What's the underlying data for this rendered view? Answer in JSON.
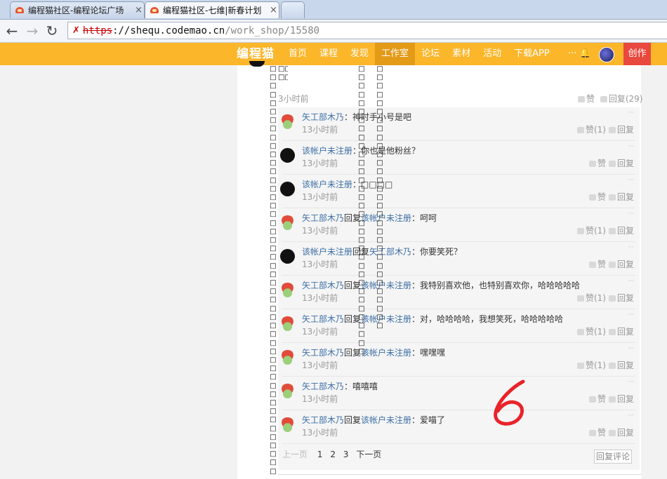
{
  "browser": {
    "tabs": [
      {
        "title": "编程猫社区-编程论坛广场",
        "active": false
      },
      {
        "title": "编程猫社区-七维|新春计划",
        "active": true
      },
      {
        "title": "",
        "active": false
      }
    ],
    "close_glyph": "×",
    "url": {
      "scheme": "https",
      "host": "://shequ.codemao.cn",
      "path": "/work_shop/15580"
    }
  },
  "header": {
    "logo": "编程猫",
    "nav": [
      {
        "label": "首页",
        "active": false
      },
      {
        "label": "课程",
        "active": false
      },
      {
        "label": "发现",
        "active": false
      },
      {
        "label": "工作室",
        "active": true
      },
      {
        "label": "论坛",
        "active": false
      },
      {
        "label": "素材",
        "active": false
      },
      {
        "label": "活动",
        "active": false
      },
      {
        "label": "下载APP",
        "active": false
      }
    ],
    "more": "···",
    "create": "创作",
    "colors": {
      "bar": "#fbb62a",
      "active": "#e39a17",
      "create": "#e8483e"
    }
  },
  "post": {
    "time": "3小时前",
    "like_label": "赞",
    "reply_label": "回复(29)"
  },
  "replies": [
    {
      "avatar": "mushroom",
      "user": "矢工部木乃",
      "reply_word": "",
      "target": "",
      "text": "：神时手小号是吧",
      "time": "13小时前",
      "likes": "赞(1)",
      "reply": "回复"
    },
    {
      "avatar": "black",
      "user": "该帐户未注册",
      "reply_word": "",
      "target": "",
      "text": "：你也是他粉丝？",
      "time": "13小时前",
      "likes": "赞",
      "reply": "回复"
    },
    {
      "avatar": "black",
      "user": "该帐户未注册",
      "reply_word": "",
      "target": "",
      "text": "：□□□□",
      "time": "13小时前",
      "likes": "赞",
      "reply": "回复"
    },
    {
      "avatar": "mushroom",
      "user": "矢工部木乃",
      "reply_word": "回复",
      "target": "该帐户未注册",
      "text": "：呵呵",
      "time": "13小时前",
      "likes": "赞(1)",
      "reply": "回复"
    },
    {
      "avatar": "black",
      "user": "该帐户未注册",
      "reply_word": "回复",
      "target": "矢工部木乃",
      "text": "：你要笑死？",
      "time": "13小时前",
      "likes": "赞",
      "reply": "回复"
    },
    {
      "avatar": "mushroom",
      "user": "矢工部木乃",
      "reply_word": "回复",
      "target": "该帐户未注册",
      "text": "：我特别喜欢他，也特别喜欢你，哈哈哈哈哈",
      "time": "13小时前",
      "likes": "赞(1)",
      "reply": "回复"
    },
    {
      "avatar": "mushroom",
      "user": "矢工部木乃",
      "reply_word": "回复",
      "target": "该帐户未注册",
      "text": "：对，哈哈哈哈，我想笑死，哈哈哈哈哈",
      "time": "13小时前",
      "likes": "赞(1)",
      "reply": "回复"
    },
    {
      "avatar": "mushroom",
      "user": "矢工部木乃",
      "reply_word": "回复",
      "target": "该帐户未注册",
      "text": "：嘿嘿嘿",
      "time": "13小时前",
      "likes": "赞(1)",
      "reply": "回复"
    },
    {
      "avatar": "mushroom",
      "user": "矢工部木乃",
      "reply_word": "",
      "target": "",
      "text": "：嘻嘻嘻",
      "time": "13小时前",
      "likes": "赞",
      "reply": "回复"
    },
    {
      "avatar": "mushroom",
      "user": "矢工部木乃",
      "reply_word": "回复",
      "target": "该帐户未注册",
      "text": "：爱喵了",
      "time": "13小时前",
      "likes": "赞",
      "reply": "回复"
    }
  ],
  "pager": {
    "prev": "上一页",
    "pages": [
      "1",
      "2",
      "3"
    ],
    "current": "1",
    "next": "下一页",
    "reply_comment": "回复评论"
  },
  "artifact": {
    "glyph": "□",
    "annotation_color": "#e8232a"
  }
}
